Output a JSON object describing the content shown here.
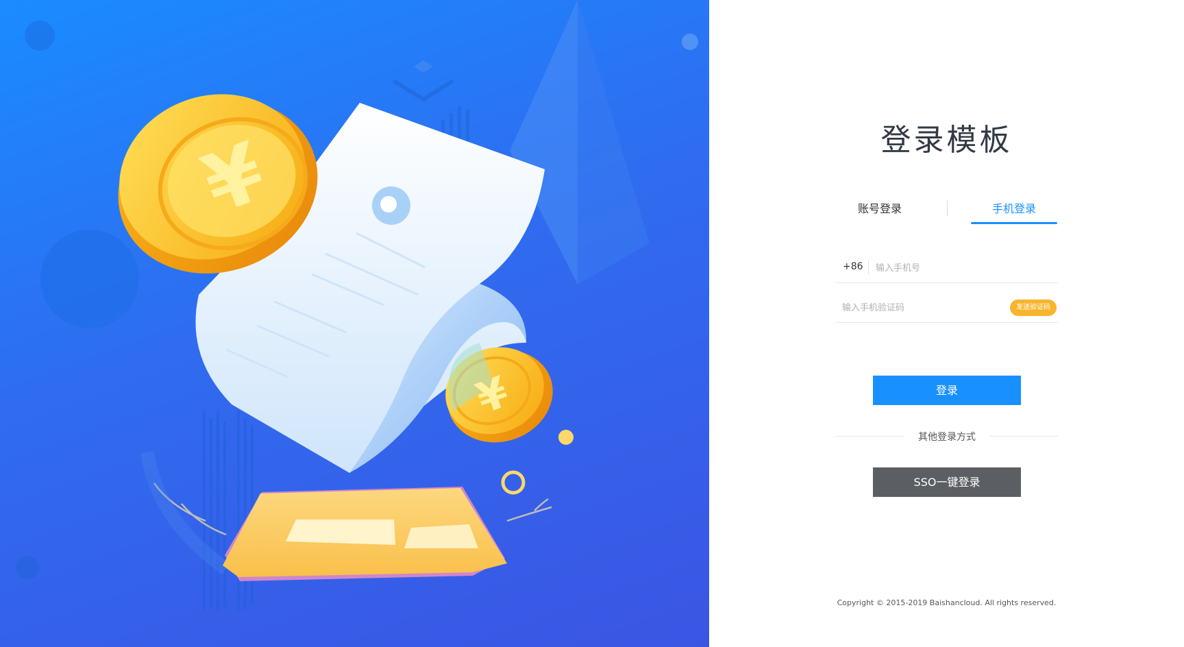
{
  "login": {
    "title": "登录模板",
    "tabs": [
      {
        "label": "账号登录",
        "active": false
      },
      {
        "label": "手机登录",
        "active": true
      }
    ],
    "phone": {
      "prefix": "+86",
      "placeholder": "输入手机号",
      "value": ""
    },
    "code": {
      "placeholder": "输入手机验证码",
      "value": "",
      "send_label": "发送验证码"
    },
    "login_button": "登录",
    "other_methods": "其他登录方式",
    "sso_button": "SSO一键登录",
    "copyright": "Copyright © 2015-2019 Baishancloud. All rights reserved."
  },
  "colors": {
    "accent": "#1890ff",
    "send_code": "#f7b52c",
    "sso_button": "#5b5e62",
    "hero_gradient_start": "#1a8cff",
    "hero_gradient_end": "#3b55e3",
    "coin": "#f9c42a"
  },
  "illustration": {
    "icons": [
      "coin-yen-icon",
      "receipt-icon",
      "card-icon",
      "pyramid-icon",
      "bar-chart-icon"
    ]
  }
}
